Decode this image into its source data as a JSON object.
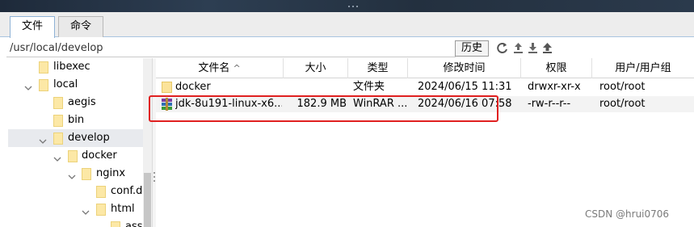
{
  "tabs": [
    {
      "label": "文件"
    },
    {
      "label": "命令"
    }
  ],
  "path": "/usr/local/develop",
  "history_label": "历史",
  "tree": [
    {
      "label": "libexec",
      "level": 1,
      "expanded": false
    },
    {
      "label": "local",
      "level": 1,
      "expanded": true
    },
    {
      "label": "aegis",
      "level": 2,
      "expanded": false
    },
    {
      "label": "bin",
      "level": 2,
      "expanded": false
    },
    {
      "label": "develop",
      "level": 2,
      "expanded": true,
      "selected": true
    },
    {
      "label": "docker",
      "level": 3,
      "expanded": true
    },
    {
      "label": "nginx",
      "level": 4,
      "expanded": true
    },
    {
      "label": "conf.d",
      "level": 5,
      "expanded": false
    },
    {
      "label": "html",
      "level": 5,
      "expanded": true
    },
    {
      "label": "asse",
      "level": 6,
      "expanded": false
    }
  ],
  "columns": [
    "文件名",
    "大小",
    "类型",
    "修改时间",
    "权限",
    "用户/用户组"
  ],
  "sort_indicator": "^",
  "files": [
    {
      "name": "docker",
      "size": "",
      "type": "文件夹",
      "mtime": "2024/06/15 11:31",
      "perm": "drwxr-xr-x",
      "owner": "root/root",
      "icon": "folder-icon"
    },
    {
      "name": "jdk-8u191-linux-x6...",
      "size": "182.9 MB",
      "type": "WinRAR ...",
      "mtime": "2024/06/16 07:58",
      "perm": "-rw-r--r--",
      "owner": "root/root",
      "icon": "rar-archive-icon"
    }
  ],
  "watermark": "CSDN @hrui0706",
  "colors": {
    "highlight": "#e02020",
    "selection": "#e8eaee",
    "folder": "#fce8a6"
  }
}
